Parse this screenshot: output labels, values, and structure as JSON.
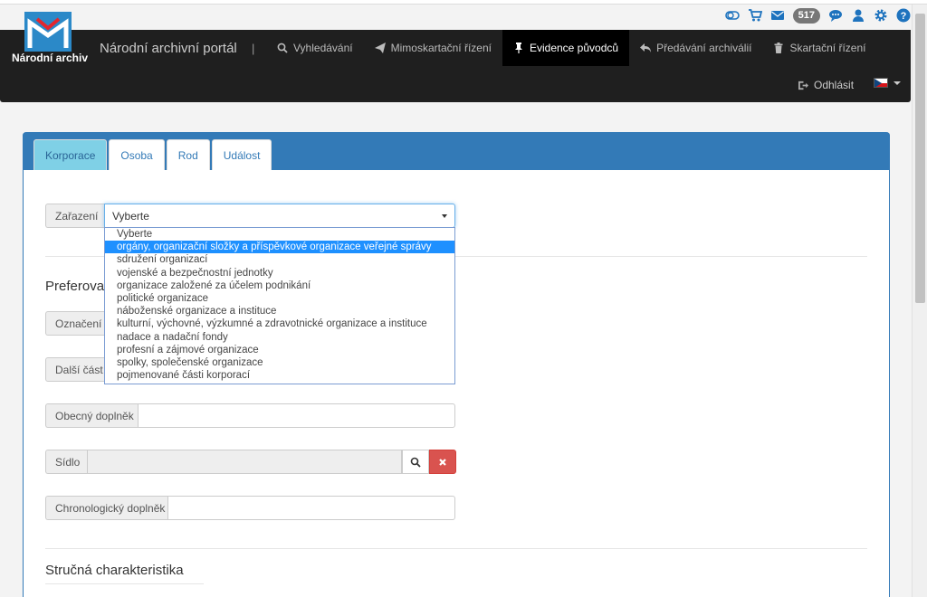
{
  "header": {
    "logo_text": "Národní archiv",
    "brand": "Národní archivní portál",
    "separator": "|",
    "badge_count": "517",
    "nav": [
      {
        "label": "Vyhledávání",
        "icon": "search-icon"
      },
      {
        "label": "Mimoskartační řízení",
        "icon": "paper-plane-icon"
      },
      {
        "label": "Evidence původců",
        "icon": "pin-icon"
      },
      {
        "label": "Předávání archiválií",
        "icon": "reply-icon"
      },
      {
        "label": "Skartační řízení",
        "icon": "trash-icon"
      }
    ],
    "logout": "Odhlásit"
  },
  "tabs": [
    "Korporace",
    "Osoba",
    "Rod",
    "Událost"
  ],
  "form": {
    "zarazeni_label": "Zařazení",
    "zarazeni_value": "Vyberte",
    "preferred_title": "Preferovan",
    "oznaceni_label": "Označení (",
    "dalsi_cast_label": "Další část j",
    "obecny_label": "Obecný doplněk",
    "sidlo_label": "Sídlo",
    "chrono_label": "Chronologický doplněk",
    "strucna_title": "Stručná charakteristika"
  },
  "dropdown_options": [
    "Vyberte",
    "orgány, organizační složky a příspěvkové organizace veřejné správy",
    "sdružení organizací",
    "vojenské a bezpečnostní jednotky",
    "organizace založené za účelem podnikání",
    "politické organizace",
    "náboženské organizace a instituce",
    "kulturní, výchovné, výzkumné a zdravotnické organizace a instituce",
    "nadace a nadační fondy",
    "profesní a zájmové organizace",
    "spolky, společenské organizace",
    "pojmenované části korporací"
  ],
  "colors": {
    "accent": "#337ab7",
    "icons": "#1e73be",
    "danger": "#d9534f",
    "navbar": "#1f1f1f"
  }
}
